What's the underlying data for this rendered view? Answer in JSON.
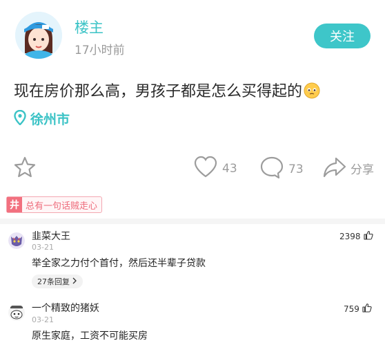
{
  "header": {
    "author": "楼主",
    "time": "17小时前",
    "follow_label": "关注"
  },
  "post": {
    "text": "现在房价那么高，男孩子都是怎么买得起的",
    "location": "徐州市"
  },
  "actions": {
    "like_count": "43",
    "comment_count": "73",
    "share_label": "分享"
  },
  "tag": {
    "symbol": "井",
    "text": "总有一句话贼走心"
  },
  "comments": [
    {
      "name": "韭菜大王",
      "date": "03-21",
      "text": "举全家之力付个首付，然后还半辈子贷款",
      "likes": "2398",
      "replies": "27条回复"
    },
    {
      "name": "一个精致的猪妖",
      "date": "03-21",
      "text": "原生家庭，工资不可能买房",
      "likes": "759"
    }
  ],
  "colors": {
    "accent": "#3ec6c9",
    "tag": "#f2707f",
    "muted": "#9c9c9c"
  }
}
